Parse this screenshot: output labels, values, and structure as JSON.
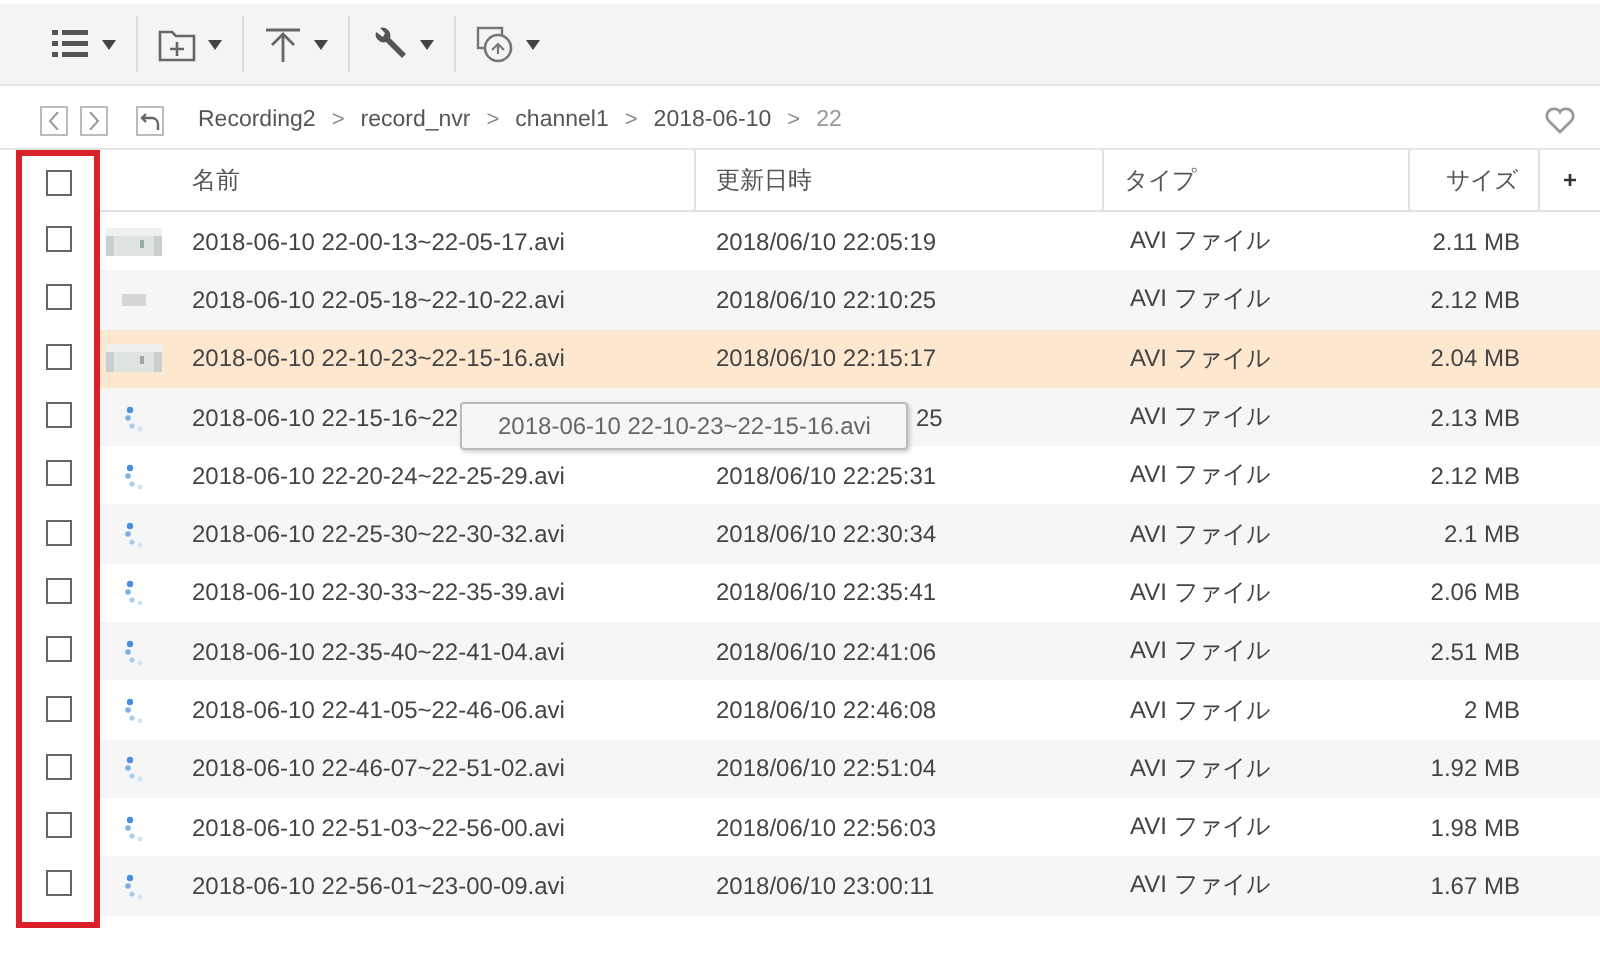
{
  "toolbar": {
    "buttons": [
      {
        "kind": "list"
      },
      {
        "kind": "new-folder"
      },
      {
        "kind": "upload"
      },
      {
        "kind": "tools"
      },
      {
        "kind": "share"
      }
    ]
  },
  "breadcrumb": {
    "path": [
      {
        "label": "Recording2",
        "current": false
      },
      {
        "label": "record_nvr",
        "current": false
      },
      {
        "label": "channel1",
        "current": false
      },
      {
        "label": "2018-06-10",
        "current": false
      },
      {
        "label": "22",
        "current": true
      }
    ],
    "separator": ">"
  },
  "table": {
    "columns": [
      "名前",
      "更新日時",
      "タイプ",
      "サイズ"
    ],
    "add_column": "+",
    "rows": [
      {
        "name": "2018-06-10 22-00-13~22-05-17.avi",
        "date": "2018/06/10 22:05:19",
        "type": "AVI ファイル",
        "size": "2.11 MB",
        "selected": false,
        "checked": false
      },
      {
        "kind": "blank",
        "name": "2018-06-10 22-05-18~22-10-22.avi",
        "date": "2018/06/10 22:10:25",
        "type": "AVI ファイル",
        "size": "2.12 MB",
        "selected": false,
        "checked": false
      },
      {
        "name": "2018-06-10 22-10-23~22-15-16.avi",
        "date": "2018/06/10 22:15:17",
        "type": "AVI ファイル",
        "size": "2.04 MB",
        "selected": true,
        "checked": false
      },
      {
        "kind": "loading",
        "name": "2018-06-10 22-15-16~22",
        "date": "25",
        "type": "AVI ファイル",
        "size": "2.13 MB",
        "selected": false,
        "checked": false,
        "under_tooltip": true
      },
      {
        "kind": "loading",
        "name": "2018-06-10 22-20-24~22-25-29.avi",
        "date": "2018/06/10 22:25:31",
        "type": "AVI ファイル",
        "size": "2.12 MB",
        "selected": false,
        "checked": false
      },
      {
        "kind": "loading",
        "name": "2018-06-10 22-25-30~22-30-32.avi",
        "date": "2018/06/10 22:30:34",
        "type": "AVI ファイル",
        "size": "2.1 MB",
        "selected": false,
        "checked": false
      },
      {
        "kind": "loading",
        "name": "2018-06-10 22-30-33~22-35-39.avi",
        "date": "2018/06/10 22:35:41",
        "type": "AVI ファイル",
        "size": "2.06 MB",
        "selected": false,
        "checked": false
      },
      {
        "kind": "loading",
        "name": "2018-06-10 22-35-40~22-41-04.avi",
        "date": "2018/06/10 22:41:06",
        "type": "AVI ファイル",
        "size": "2.51 MB",
        "selected": false,
        "checked": false
      },
      {
        "kind": "loading",
        "name": "2018-06-10 22-41-05~22-46-06.avi",
        "date": "2018/06/10 22:46:08",
        "type": "AVI ファイル",
        "size": "2 MB",
        "selected": false,
        "checked": false
      },
      {
        "kind": "loading",
        "name": "2018-06-10 22-46-07~22-51-02.avi",
        "date": "2018/06/10 22:51:04",
        "type": "AVI ファイル",
        "size": "1.92 MB",
        "selected": false,
        "checked": false
      },
      {
        "kind": "loading",
        "name": "2018-06-10 22-51-03~22-56-00.avi",
        "date": "2018/06/10 22:56:03",
        "type": "AVI ファイル",
        "size": "1.98 MB",
        "selected": false,
        "checked": false
      },
      {
        "kind": "loading",
        "name": "2018-06-10 22-56-01~23-00-09.avi",
        "date": "2018/06/10 23:00:11",
        "type": "AVI ファイル",
        "size": "1.67 MB",
        "selected": false,
        "checked": false
      }
    ],
    "header_checked": false,
    "highlight_checkbox_column": true
  },
  "tooltip": {
    "text": "2018-06-10 22-10-23~22-15-16.avi"
  }
}
